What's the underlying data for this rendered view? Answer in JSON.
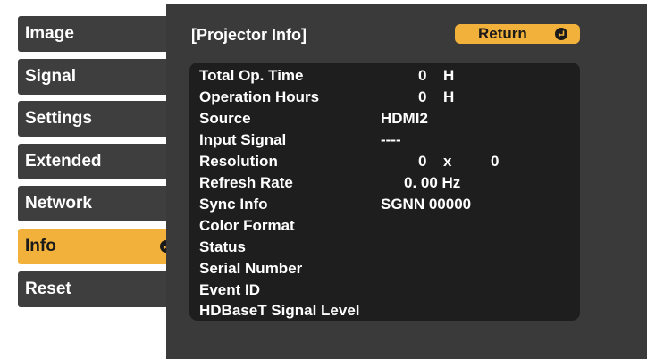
{
  "sidebar": {
    "items": [
      {
        "label": "Image"
      },
      {
        "label": "Signal"
      },
      {
        "label": "Settings"
      },
      {
        "label": "Extended"
      },
      {
        "label": "Network"
      },
      {
        "label": "Info"
      },
      {
        "label": "Reset"
      }
    ],
    "active_index": 5
  },
  "panel": {
    "title": "[Projector Info]",
    "return_label": "Return"
  },
  "info": {
    "total_op_time": {
      "label": "Total Op. Time",
      "value": "0",
      "unit": "H"
    },
    "operation_hours": {
      "label": "Operation Hours",
      "value": "0",
      "unit": "H"
    },
    "source": {
      "label": "Source",
      "value": "HDMI2"
    },
    "input_signal": {
      "label": "Input Signal",
      "value": "----"
    },
    "resolution": {
      "label": "Resolution",
      "width": "0",
      "sep": "x",
      "height": "0"
    },
    "refresh_rate": {
      "label": "Refresh Rate",
      "value": "0. 00 Hz"
    },
    "sync_info": {
      "label": "Sync Info",
      "value": "SGNN 00000"
    },
    "color_format": {
      "label": "Color Format",
      "value": ""
    },
    "status": {
      "label": "Status",
      "value": ""
    },
    "serial_number": {
      "label": "Serial Number",
      "value": ""
    },
    "event_id": {
      "label": "Event ID",
      "value": ""
    },
    "hdbaset_level": {
      "label": "HDBaseT Signal Level",
      "value": ""
    }
  },
  "colors": {
    "accent": "#f1b13b",
    "menu_item_bg": "#3e3e3e",
    "panel_bg": "#3a3a3a",
    "info_box_bg": "#1e1e1e"
  },
  "icons": {
    "enter": "enter-arrow-icon"
  }
}
